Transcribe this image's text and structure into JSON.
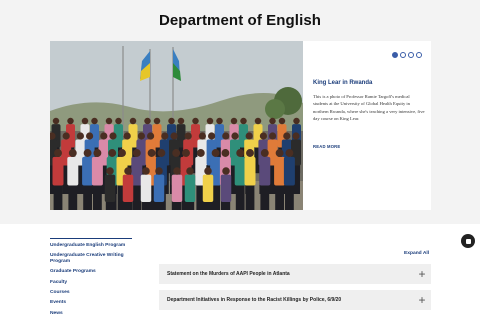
{
  "header": {
    "title": "Department of English"
  },
  "carousel": {
    "slide_count": 4,
    "active_slide": 1,
    "slide": {
      "title": "King Lear in Rwanda",
      "body": "This is a photo of Professor Ramie Targoff's medical students at the University of Global Health Equity in northern Rwanda, where she's teaching a very intensive, five day course on King Lear.",
      "read_more": "READ MORE"
    }
  },
  "sidebar": {
    "items": [
      {
        "label": "Undergraduate English Program"
      },
      {
        "label": "Undergraduate Creative Writing Program"
      },
      {
        "label": "Graduate Programs"
      },
      {
        "label": "Faculty"
      },
      {
        "label": "Courses"
      },
      {
        "label": "Events"
      },
      {
        "label": "News"
      }
    ]
  },
  "main": {
    "expand_all": "Expand All",
    "accordion": [
      {
        "label": "Statement on the Murders of AAPI People in Atlanta"
      },
      {
        "label": "Department Initiatives in Response to the Racist Killings by Police, 6/9/20"
      }
    ]
  },
  "icons": {
    "expand": "plus-icon",
    "chat": "chat-icon",
    "dots": "slide-dot"
  },
  "colors": {
    "brand": "#1a3c7a",
    "panel": "#f3f3f3",
    "accordion_bg": "#efefef"
  }
}
